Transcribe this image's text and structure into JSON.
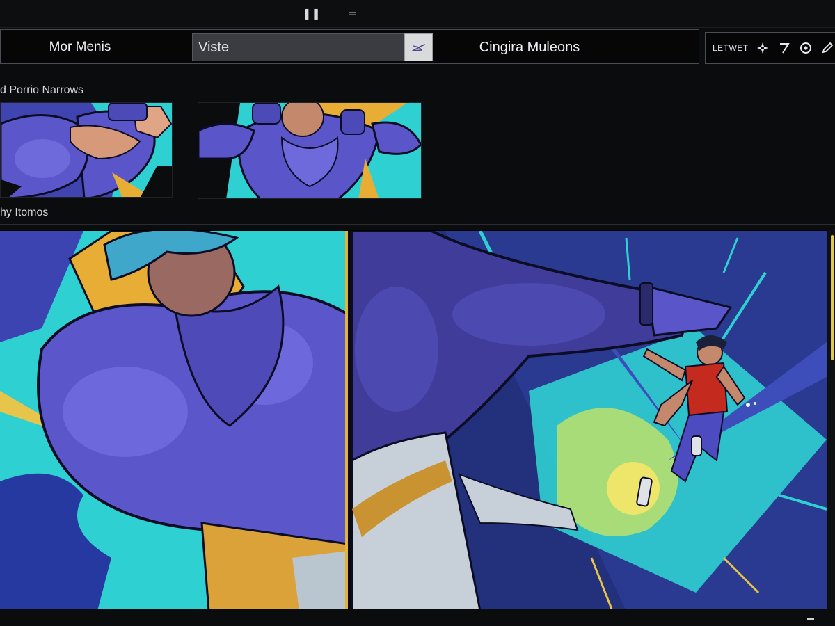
{
  "titlebar": {
    "pause_glyph": "❚❚",
    "menu_glyph": "="
  },
  "toolbar": {
    "menu_label": "Mor Menis",
    "search_value": "Viste",
    "search_button_icon": "send-arrow-icon",
    "title": "Cingira Muleons"
  },
  "right_tools": {
    "label": "LETWET",
    "icons": [
      "settings-spark-icon",
      "slash-icon",
      "record-icon",
      "edit-pencil-icon"
    ]
  },
  "sections": {
    "top_label": "d Porrio Narrows",
    "bottom_label": "hy Itomos"
  },
  "colors": {
    "accent_yellow": "#e4c845",
    "cyan": "#35d6d6",
    "violet": "#5c58c6",
    "deep_blue": "#22307a",
    "red": "#c42a1e"
  }
}
